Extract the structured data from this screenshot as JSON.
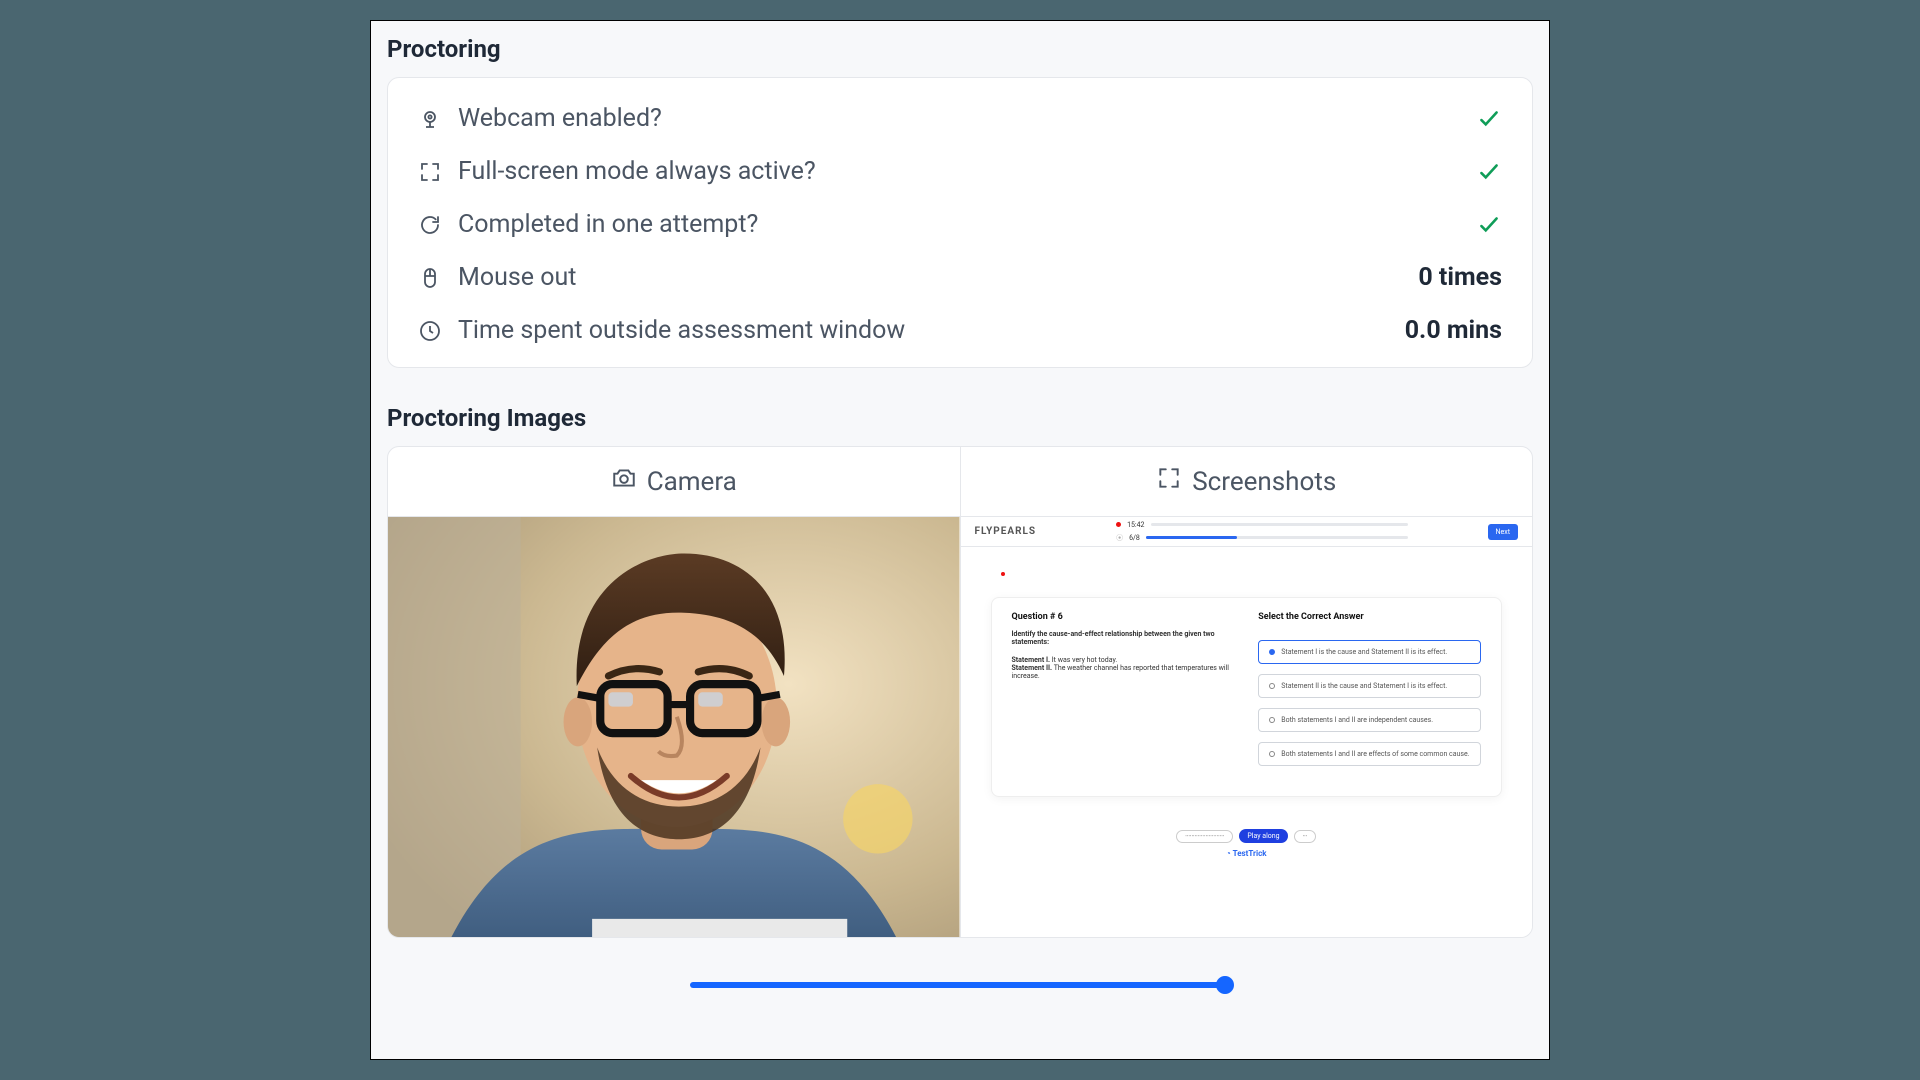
{
  "sections": {
    "proctoring_title": "Proctoring",
    "images_title": "Proctoring Images"
  },
  "checks": [
    {
      "icon": "webcam",
      "label": "Webcam enabled?",
      "status": "check"
    },
    {
      "icon": "fullscreen",
      "label": "Full-screen mode always active?",
      "status": "check"
    },
    {
      "icon": "refresh",
      "label": "Completed in one attempt?",
      "status": "check"
    },
    {
      "icon": "mouse",
      "label": "Mouse out",
      "value": "0 times"
    },
    {
      "icon": "clock",
      "label": "Time spent outside assessment window",
      "value": "0.0 mins"
    }
  ],
  "tabs": {
    "camera": "Camera",
    "screenshots": "Screenshots"
  },
  "screenshot": {
    "brand": "FLYPEARLS",
    "timer": "15:42",
    "qcount": "6/8",
    "next": "Next",
    "question_heading": "Question # 6",
    "answer_heading": "Select the Correct Answer",
    "prompt": "Identify the cause-and-effect relationship between the given two statements:",
    "statement1_label": "Statement I.",
    "statement1_text": "It was very hot today.",
    "statement2_label": "Statement II.",
    "statement2_text": "The weather channel has reported that temperatures will increase.",
    "options": [
      "Statement I is the cause and Statement II is its effect.",
      "Statement II is the cause and Statement I is its effect.",
      "Both statements I and II are independent causes.",
      "Both statements I and II are effects of some common cause."
    ],
    "pill": "Play along",
    "footer_brand": "TestTrick"
  }
}
